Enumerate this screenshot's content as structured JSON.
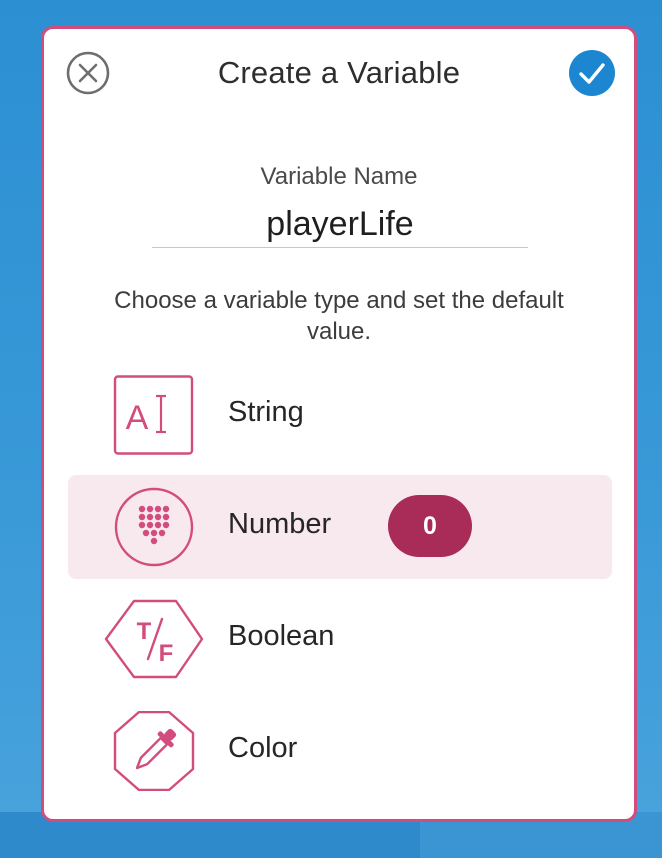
{
  "dialog": {
    "title": "Create a Variable",
    "close_icon": "close-circle-icon",
    "confirm_icon": "checkmark-circle-icon"
  },
  "name_field": {
    "label": "Variable Name",
    "value": "playerLife"
  },
  "instructions": "Choose a variable type and set the default value.",
  "types": [
    {
      "label": "String",
      "icon": "string-type-icon",
      "selected": false
    },
    {
      "label": "Number",
      "icon": "number-type-icon",
      "selected": true,
      "default_value": "0"
    },
    {
      "label": "Boolean",
      "icon": "boolean-type-icon",
      "selected": false
    },
    {
      "label": "Color",
      "icon": "color-dropper-icon",
      "selected": false
    }
  ],
  "colors": {
    "accent": "#d24d7d",
    "accent_dark": "#a92b57",
    "selected_row_bg": "#f8e9ee",
    "confirm_blue": "#1d86d0"
  }
}
